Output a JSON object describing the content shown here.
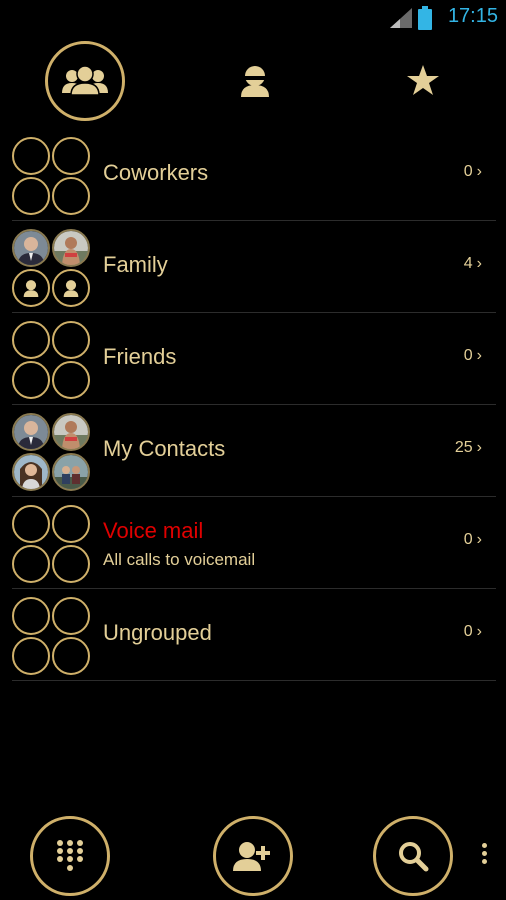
{
  "status_bar": {
    "time": "17:15",
    "signal_icon": "signal-icon",
    "battery_icon": "battery-icon"
  },
  "tabs": [
    {
      "name": "groups",
      "icon": "groups-icon",
      "selected": true
    },
    {
      "name": "contacts",
      "icon": "person-icon",
      "selected": false
    },
    {
      "name": "favorites",
      "icon": "star-icon",
      "selected": false
    }
  ],
  "groups": [
    {
      "title": "Coworkers",
      "subtitle": "",
      "count": "0"
    },
    {
      "title": "Family",
      "subtitle": "",
      "count": "4"
    },
    {
      "title": "Friends",
      "subtitle": "",
      "count": "0"
    },
    {
      "title": "My Contacts",
      "subtitle": "",
      "count": "25"
    },
    {
      "title": "Voice mail",
      "subtitle": "All calls to voicemail",
      "count": "0"
    },
    {
      "title": "Ungrouped",
      "subtitle": "",
      "count": "0"
    }
  ],
  "bottom_bar": {
    "buttons": [
      {
        "name": "dialpad",
        "icon": "dialpad-icon"
      },
      {
        "name": "add-contact",
        "icon": "add-contact-icon"
      },
      {
        "name": "search",
        "icon": "search-icon"
      }
    ],
    "overflow_icon": "overflow-menu-icon"
  },
  "colors": {
    "gold": "#cfb06a",
    "text": "#e3cf98",
    "accent_red": "#e00000",
    "clock_blue": "#33b5e5",
    "background": "#000000"
  }
}
